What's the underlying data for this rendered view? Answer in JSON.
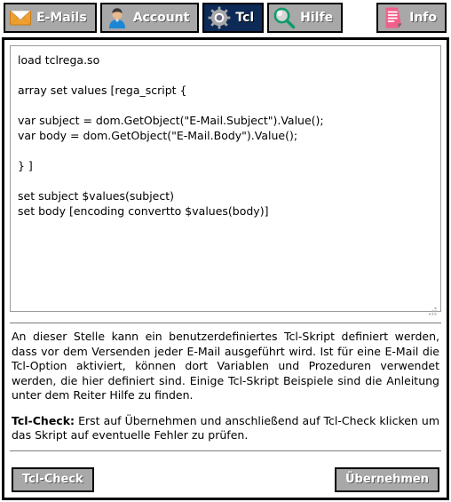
{
  "tabs": [
    {
      "label": "E-Mails",
      "icon": "envelope-icon",
      "active": false
    },
    {
      "label": "Account",
      "icon": "person-icon",
      "active": false
    },
    {
      "label": "Tcl",
      "icon": "gear-icon",
      "active": true
    },
    {
      "label": "Hilfe",
      "icon": "magnifier-icon",
      "active": false
    }
  ],
  "info_button": {
    "label": "Info",
    "icon": "document-icon"
  },
  "editor": {
    "value": "load tclrega.so\n\narray set values [rega_script {\n\nvar subject = dom.GetObject(\"E-Mail.Subject\").Value();\nvar body = dom.GetObject(\"E-Mail.Body\").Value();\n\n} ]\n\nset subject $values(subject)\nset body [encoding convertto $values(body)]",
    "placeholder": ""
  },
  "description": "An dieser Stelle kann ein benutzerdefiniertes Tcl-Skript definiert werden, dass vor dem Versenden jeder E-Mail ausgeführt wird. Ist für eine E-Mail die Tcl-Option aktiviert, können dort Variablen und Prozeduren verwendet werden, die hier definiert sind. Einige Tcl-Skript Beispiele sind die Anleitung unter dem Reiter Hilfe zu finden.",
  "note": {
    "bold": "Tcl-Check:",
    "text": " Erst auf Übernehmen und anschließend auf Tcl-Check klicken um das Skript auf eventuelle Fehler zu prüfen."
  },
  "buttons": {
    "check": "Tcl-Check",
    "apply": "Übernehmen"
  },
  "colors": {
    "tab_inactive_bg": "#a8a8a8",
    "tab_active_bg": "#0d2a56",
    "tab_text": "#ffffff",
    "panel_border": "#000000",
    "envelope": "#f0a030",
    "magnifier": "#0f9b6c",
    "info_doc": "#f25f8a",
    "shirt": "#1c86d4"
  }
}
